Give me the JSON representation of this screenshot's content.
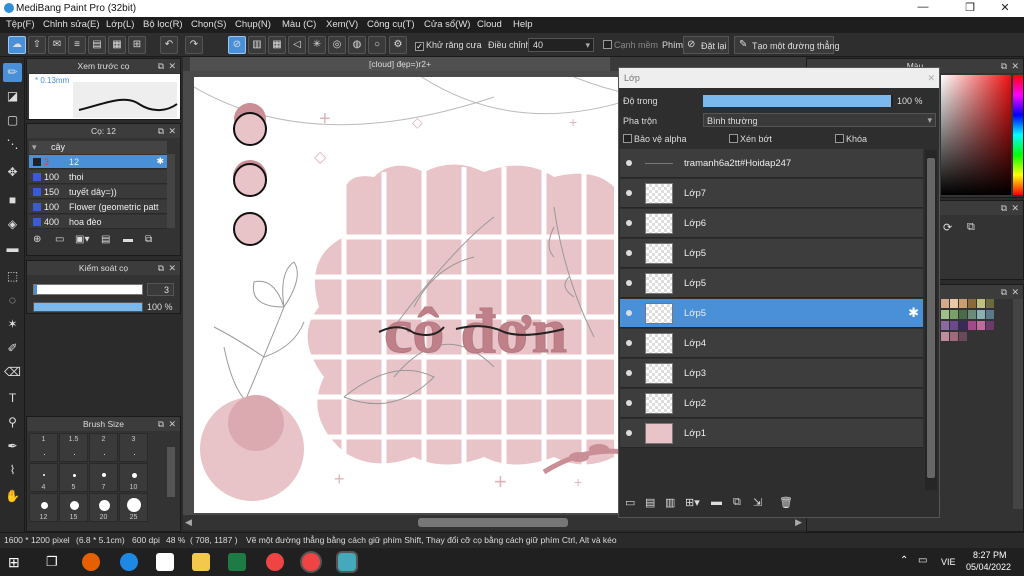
{
  "window": {
    "title": "MediBang Paint Pro (32bit)",
    "controls": {
      "minimize": "—",
      "maximize": "❐",
      "close": "✕"
    }
  },
  "menu": [
    "Tệp(F)",
    "Chỉnh sửa(E)",
    "Lớp(L)",
    "Bộ lọc(R)",
    "Chọn(S)",
    "Chụp(N)",
    "Màu (C)",
    "Xem(V)",
    "Công cụ(T)",
    "Cửa sổ(W)",
    "Cloud",
    "Help"
  ],
  "toolbar": {
    "antialias_label": "Khử răng cưa",
    "adjust_label": "Điều chỉnh",
    "adjust_value": "40",
    "snap_label": "Cạnh mềm",
    "key_label": "Phím",
    "reset_label": "Đặt lại",
    "new_line_label": "Tạo một đường thẳng"
  },
  "preview_panel": {
    "title": "Xem trước cọ",
    "size_text": "0.13mm"
  },
  "brush_panel": {
    "title": "Cọ: 12",
    "group": "cây",
    "items": [
      {
        "size": "3",
        "name": "12",
        "selected": true
      },
      {
        "size": "100",
        "name": "thoi",
        "selected": false
      },
      {
        "size": "150",
        "name": "tuyết dây=))",
        "selected": false
      },
      {
        "size": "100",
        "name": "Flower (geometric patt",
        "selected": false
      },
      {
        "size": "400",
        "name": "hoa đèo",
        "selected": false
      }
    ]
  },
  "brush_control": {
    "title": "Kiểm soát cọ",
    "size_value": "3",
    "opacity_value": "100 %",
    "opacity_fraction": 1.0
  },
  "brush_size_panel": {
    "title": "Brush Size",
    "labels": [
      "1",
      "1.5",
      "2",
      "3",
      "4",
      "5",
      "7",
      "10",
      "12",
      "15",
      "20",
      "25"
    ]
  },
  "document": {
    "tab_label": "[cloud] đẹp=)r2+",
    "canvas_text": "cô đơn"
  },
  "layer_panel": {
    "title": "Lớp",
    "opacity_label": "Độ trong",
    "opacity_value": "100 %",
    "opacity_fraction": 1.0,
    "blend_label": "Pha trộn",
    "blend_value": "Bình thường",
    "protect_alpha": "Bảo vệ alpha",
    "clipping": "Xén bớt",
    "lock": "Khóa",
    "layers": [
      {
        "name": "tramanh6a2tt#Hoidap247",
        "selected": false
      },
      {
        "name": "Lớp7",
        "selected": false
      },
      {
        "name": "Lớp6",
        "selected": false
      },
      {
        "name": "Lớp5",
        "selected": false
      },
      {
        "name": "Lớp5",
        "selected": false
      },
      {
        "name": "Lớp5",
        "selected": true
      },
      {
        "name": "Lớp4",
        "selected": false
      },
      {
        "name": "Lớp3",
        "selected": false
      },
      {
        "name": "Lớp2",
        "selected": false
      },
      {
        "name": "Lớp1",
        "selected": false
      }
    ]
  },
  "right_panel": {
    "color_title": "Màu"
  },
  "status": {
    "size": "1600 * 1200 pixel",
    "physical": "(6.8 * 5.1cm)",
    "dpi": "600 dpi",
    "zoom": "48 %",
    "coords": "( 708, 1187 )",
    "hint": "Vẽ một đường thẳng bằng cách giữ phím Shift, Thay đổi cỡ cọ bằng cách giữ phím Ctrl, Alt và kéo"
  },
  "taskbar": {
    "lang": "VIE",
    "time": "8:27 PM",
    "date": "05/04/2022"
  },
  "colors": {
    "accent": "#4a90d9",
    "pink": "#e8c3c8",
    "pink_dark": "#c98e96"
  }
}
